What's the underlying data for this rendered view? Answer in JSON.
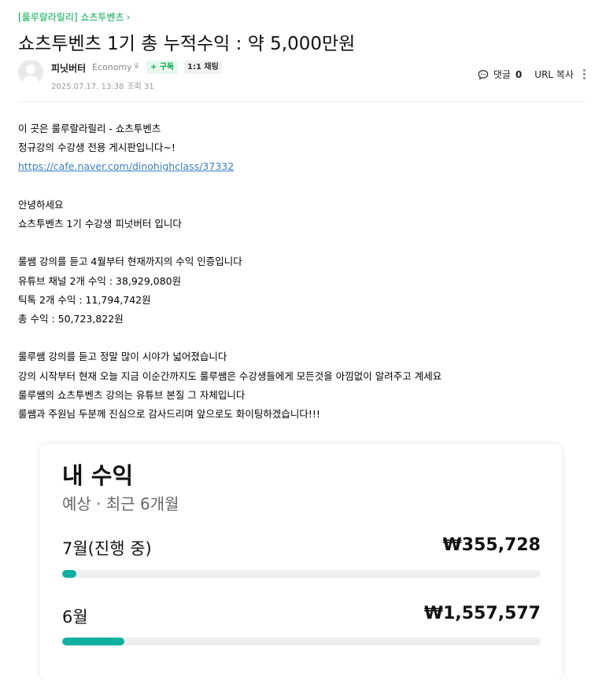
{
  "breadcrumb": {
    "prefix": "[룰루랄라릴리]",
    "board": "쇼츠투벤츠",
    "chevron": "›"
  },
  "title": "쇼츠투벤츠 1기 총 누적수익 : 약 5,000만원",
  "author": {
    "nickname": "피닛버터",
    "grade": "Economy",
    "subscribe_label": "+ 구독",
    "chat_label": "1:1 채팅",
    "date": "2025.07.17. 13:38",
    "views": "조회 31"
  },
  "tools": {
    "comment_label": "댓글",
    "comment_count": "0",
    "url_copy_label": "URL 복사"
  },
  "body": {
    "line1": "이 곳은 룰루랄라릴리 - 쇼츠투벤츠",
    "line2": "정규강의 수강생 전용 게시판입니다~!",
    "link": "https://cafe.naver.com/dinohighclass/37332",
    "line4": "안녕하세요",
    "line5": "쇼츠투벤츠 1기 수강생 피넛버터 입니다",
    "line6": "룰쌤 강의를 듣고 4월부터 현재까지의 수익 인증입니다",
    "line7": "유튜브 채널 2개 수익 : 38,929,080원",
    "line8": "틱톡 2개 수익 : 11,794,742원",
    "line9": "총 수익 : 50,723,822원",
    "line10": "룰루쌤 강의를 듣고 정말 많이 시야가 넓어졌습니다",
    "line11": "강의 시작부터 현재 오늘 지금 이순간까지도 룰루쌤은 수강생들에게 모든것을 아낌없이 알려주고 계세요",
    "line12": "룰루쌤의 쇼츠투벤츠 강의는 유튜브 본질 그 자체입니다",
    "line13": "룰쌤과 주원님 두분께 진심으로 감사드리며 앞으로도 화이팅하겠습니다!!!"
  },
  "earnings_card": {
    "title": "내 수익",
    "subtitle": "예상 · 최근 6개월",
    "bar_color": "#10b0a0",
    "rows": [
      {
        "label": "7월(진행 중)",
        "value": "₩355,728",
        "fill_fraction": 0.03
      },
      {
        "label": "6월",
        "value": "₩1,557,577",
        "fill_fraction": 0.13
      }
    ]
  }
}
